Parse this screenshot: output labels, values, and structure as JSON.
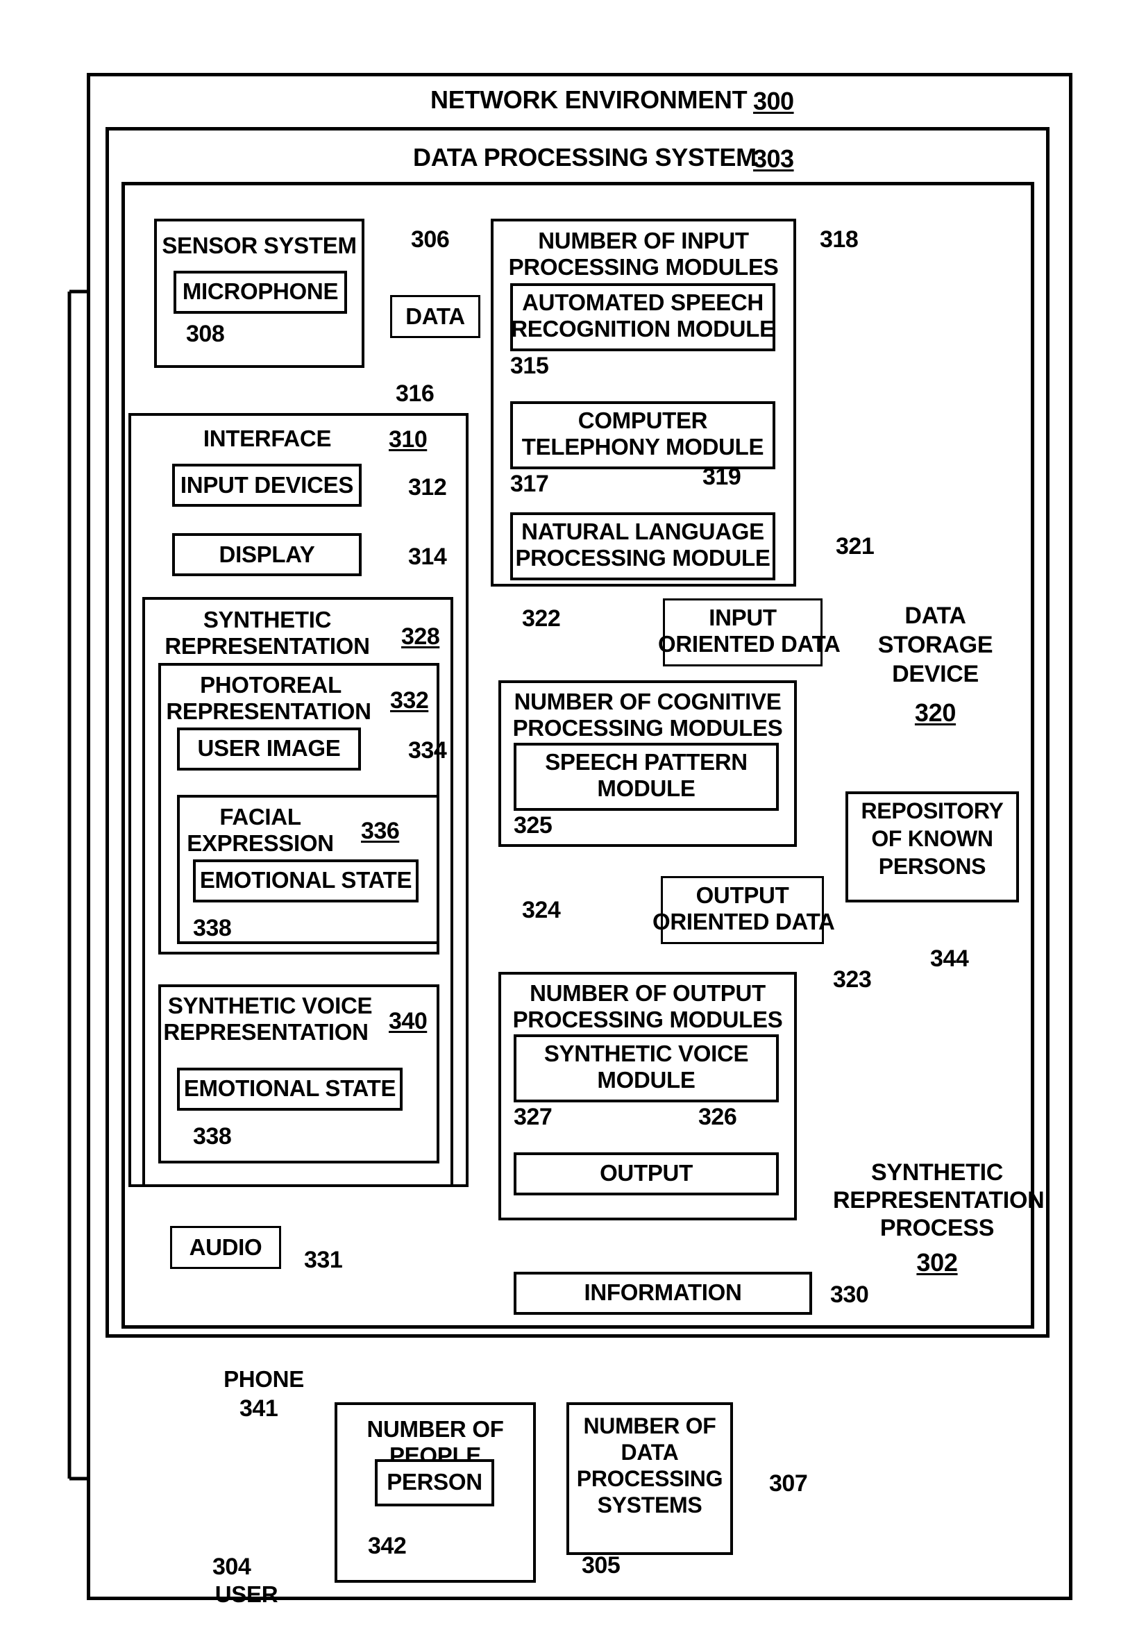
{
  "figure": {
    "outer_frame": {
      "title": "NETWORK ENVIRONMENT",
      "ref": "300"
    },
    "dps_frame": {
      "title": "DATA PROCESSING SYSTEM",
      "ref": "303"
    },
    "process_label": {
      "line1": "SYNTHETIC",
      "line2": "REPRESENTATION",
      "line3": "PROCESS",
      "ref": "302"
    }
  },
  "blocks": {
    "sensor_system": {
      "label": "SENSOR SYSTEM",
      "ref": "306"
    },
    "microphone": {
      "label": "MICROPHONE",
      "ref": "308"
    },
    "data": {
      "label": "DATA",
      "ref": "316"
    },
    "interface": {
      "label": "INTERFACE",
      "ref": "310"
    },
    "input_devices": {
      "label": "INPUT DEVICES",
      "ref": "312"
    },
    "display": {
      "label": "DISPLAY",
      "ref": "314"
    },
    "synthetic_representation": {
      "line1": "SYNTHETIC",
      "line2": "REPRESENTATION",
      "ref": "328"
    },
    "photoreal_representation": {
      "line1": "PHOTOREAL",
      "line2": "REPRESENTATION",
      "ref": "332"
    },
    "user_image": {
      "label": "USER IMAGE",
      "ref": "334"
    },
    "facial_expression": {
      "line1": "FACIAL",
      "line2": "EXPRESSION",
      "ref": "336"
    },
    "emotional_state_facial": {
      "label": "EMOTIONAL STATE",
      "ref": "338"
    },
    "synthetic_voice_representation": {
      "line1": "SYNTHETIC VOICE",
      "line2": "REPRESENTATION",
      "ref": "340"
    },
    "emotional_state_voice": {
      "label": "EMOTIONAL STATE",
      "ref": "338"
    },
    "audio": {
      "label": "AUDIO",
      "ref": "331"
    },
    "input_processing_modules": {
      "line1": "NUMBER OF INPUT",
      "line2": "PROCESSING MODULES",
      "ref": "318"
    },
    "automated_speech_recognition": {
      "line1": "AUTOMATED SPEECH",
      "line2": "RECOGNITION MODULE",
      "ref": "315"
    },
    "computer_telephony": {
      "line1": "COMPUTER",
      "line2": "TELEPHONY MODULE",
      "ref": "317"
    },
    "natural_language_processing": {
      "line1": "NATURAL LANGUAGE",
      "line2": "PROCESSING MODULE",
      "ref": "319"
    },
    "input_oriented_data": {
      "line1": "INPUT",
      "line2": "ORIENTED DATA",
      "ref": "321"
    },
    "cognitive_processing_modules": {
      "line1": "NUMBER OF COGNITIVE",
      "line2": "PROCESSING MODULES",
      "ref": "322"
    },
    "speech_pattern_module": {
      "line1": "SPEECH PATTERN",
      "line2": "MODULE",
      "ref": "325"
    },
    "output_oriented_data": {
      "line1": "OUTPUT",
      "line2": "ORIENTED DATA",
      "ref": "323"
    },
    "output_processing_modules": {
      "line1": "NUMBER OF OUTPUT",
      "line2": "PROCESSING MODULES",
      "ref": "324"
    },
    "synthetic_voice_module": {
      "line1": "SYNTHETIC VOICE",
      "line2": "MODULE",
      "ref": "327"
    },
    "output": {
      "label": "OUTPUT",
      "ref": "326"
    },
    "information": {
      "label": "INFORMATION",
      "ref": "330"
    },
    "data_storage_device": {
      "line1": "DATA",
      "line2": "STORAGE",
      "line3": "DEVICE",
      "ref": "320"
    },
    "repository_of_known_persons": {
      "line1": "REPOSITORY",
      "line2": "OF KNOWN",
      "line3": "PERSONS",
      "ref": "344"
    },
    "user": {
      "ref": "304",
      "label": "USER"
    },
    "phone": {
      "label": "PHONE",
      "ref": "341"
    },
    "number_of_people": {
      "line1": "NUMBER OF",
      "line2": "PEOPLE",
      "ref": "305"
    },
    "person": {
      "label": "PERSON",
      "ref": "342"
    },
    "number_of_data_processing_systems": {
      "line1": "NUMBER OF",
      "line2": "DATA",
      "line3": "PROCESSING",
      "line4": "SYSTEMS",
      "ref": "307"
    }
  },
  "colors": {
    "line": "#000000",
    "background": "#ffffff"
  }
}
